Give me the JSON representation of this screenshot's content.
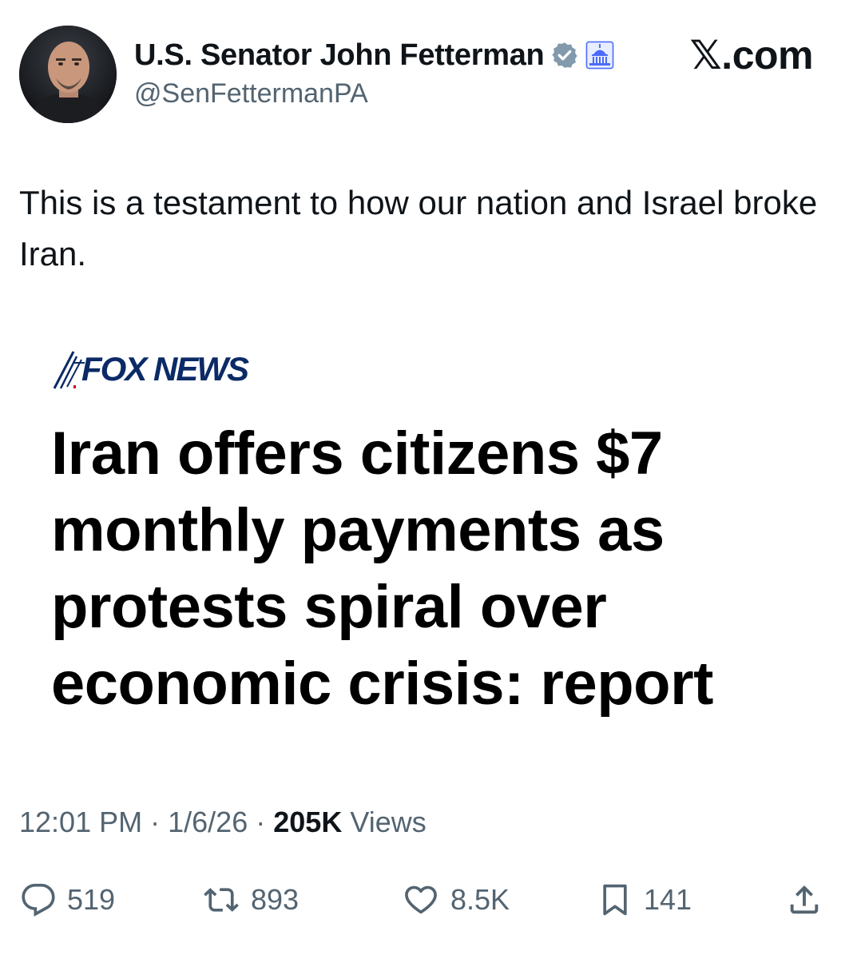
{
  "header": {
    "display_name": "U.S. Senator John Fetterman",
    "handle": "@SenFettermanPA",
    "site_brand": "𝕏.com"
  },
  "icons": {
    "verified": "verified-badge-icon",
    "affiliation": "us-capitol-icon",
    "reply": "reply-icon",
    "retweet": "retweet-icon",
    "like": "heart-icon",
    "bookmark": "bookmark-icon",
    "share": "share-icon"
  },
  "tweet": {
    "text": "This is a testament to how our nation and Israel broke Iran."
  },
  "embedded_image": {
    "source_logo": "FOX NEWS",
    "headline": "Iran offers citizens $7 monthly payments as protests spiral over economic crisis: report"
  },
  "meta": {
    "time": "12:01 PM",
    "date": "1/6/26",
    "separator": "·",
    "views_count": "205K",
    "views_label": "Views"
  },
  "actions": {
    "replies": "519",
    "reposts": "893",
    "likes": "8.5K",
    "bookmarks": "141"
  },
  "colors": {
    "text_primary": "#0f1419",
    "text_secondary": "#536471",
    "fox_blue": "#0b2a66",
    "verified_badge": "#829aab",
    "capitol_badge": "#4a6cf7"
  }
}
